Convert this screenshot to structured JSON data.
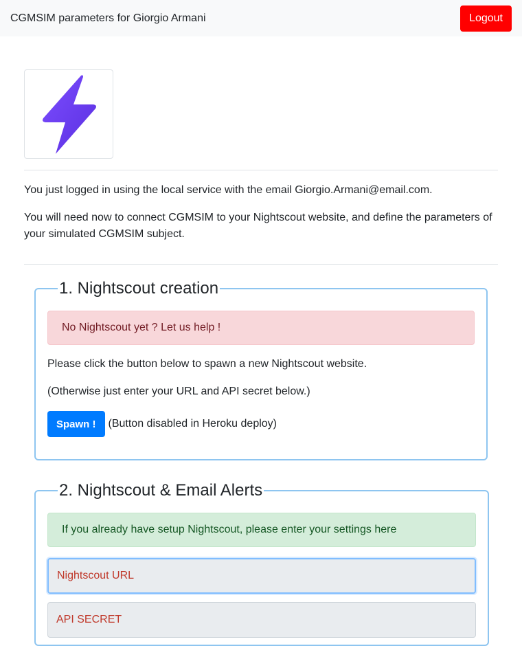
{
  "navbar": {
    "title": "CGMSIM parameters for Giorgio Armani",
    "logout_label": "Logout"
  },
  "logo": {
    "icon": "lightning-bolt-icon",
    "color": "#6a3df2"
  },
  "intro": {
    "line1": "You just logged in using the local service with the email Giorgio.Armani@email.com.",
    "line2": "You will need now to connect CGMSIM to your Nightscout website, and define the parameters of your simulated CGMSIM subject."
  },
  "section1": {
    "legend": "1. Nightscout creation",
    "alert": "No Nightscout yet ? Let us help !",
    "text1": "Please click the button below to spawn a new Nightscout website.",
    "text2": "(Otherwise just enter your URL and API secret below.)",
    "spawn_label": "Spawn !",
    "spawn_note": "(Button disabled in Heroku deploy)"
  },
  "section2": {
    "legend": "2. Nightscout & Email Alerts",
    "alert": "If you already have setup Nightscout, please enter your settings here",
    "url_placeholder": "Nightscout URL",
    "secret_placeholder": "API SECRET"
  },
  "colors": {
    "logout": "#ff0000",
    "primary": "#007bff",
    "fieldset_border": "#8ec5f0",
    "alert_danger_bg": "#f8d7da",
    "alert_success_bg": "#d4edda"
  }
}
